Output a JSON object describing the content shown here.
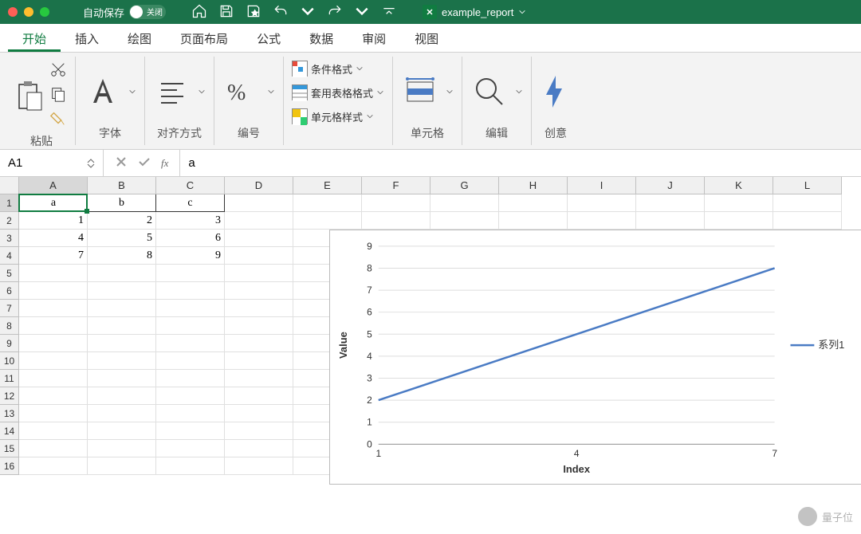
{
  "titlebar": {
    "autosave_label": "自动保存",
    "autosave_state": "关闭",
    "filename": "example_report"
  },
  "tabs": [
    "开始",
    "插入",
    "绘图",
    "页面布局",
    "公式",
    "数据",
    "审阅",
    "视图"
  ],
  "ribbon": {
    "paste": "粘贴",
    "font": "字体",
    "align": "对齐方式",
    "number": "编号",
    "cond_format": "条件格式",
    "table_format": "套用表格格式",
    "cell_style": "单元格样式",
    "cells": "单元格",
    "edit": "编辑",
    "creative": "创意"
  },
  "formula_bar": {
    "name_box": "A1",
    "fx_label": "fx",
    "value": "a"
  },
  "columns": [
    "A",
    "B",
    "C",
    "D",
    "E",
    "F",
    "G",
    "H",
    "I",
    "J",
    "K",
    "L"
  ],
  "row_count": 16,
  "sheet_data": {
    "headers": [
      "a",
      "b",
      "c"
    ],
    "rows": [
      [
        "1",
        "2",
        "3"
      ],
      [
        "4",
        "5",
        "6"
      ],
      [
        "7",
        "8",
        "9"
      ]
    ]
  },
  "chart_data": {
    "type": "line",
    "title": "",
    "xlabel": "Index",
    "ylabel": "Value",
    "x_ticks": [
      1,
      4,
      7
    ],
    "y_ticks": [
      0,
      1,
      2,
      3,
      4,
      5,
      6,
      7,
      8,
      9
    ],
    "xlim": [
      1,
      7
    ],
    "ylim": [
      0,
      9
    ],
    "legend": [
      "系列1"
    ],
    "series": [
      {
        "name": "系列1",
        "x": [
          1,
          4,
          7
        ],
        "y": [
          2,
          5,
          8
        ]
      }
    ]
  },
  "watermark": "量子位"
}
